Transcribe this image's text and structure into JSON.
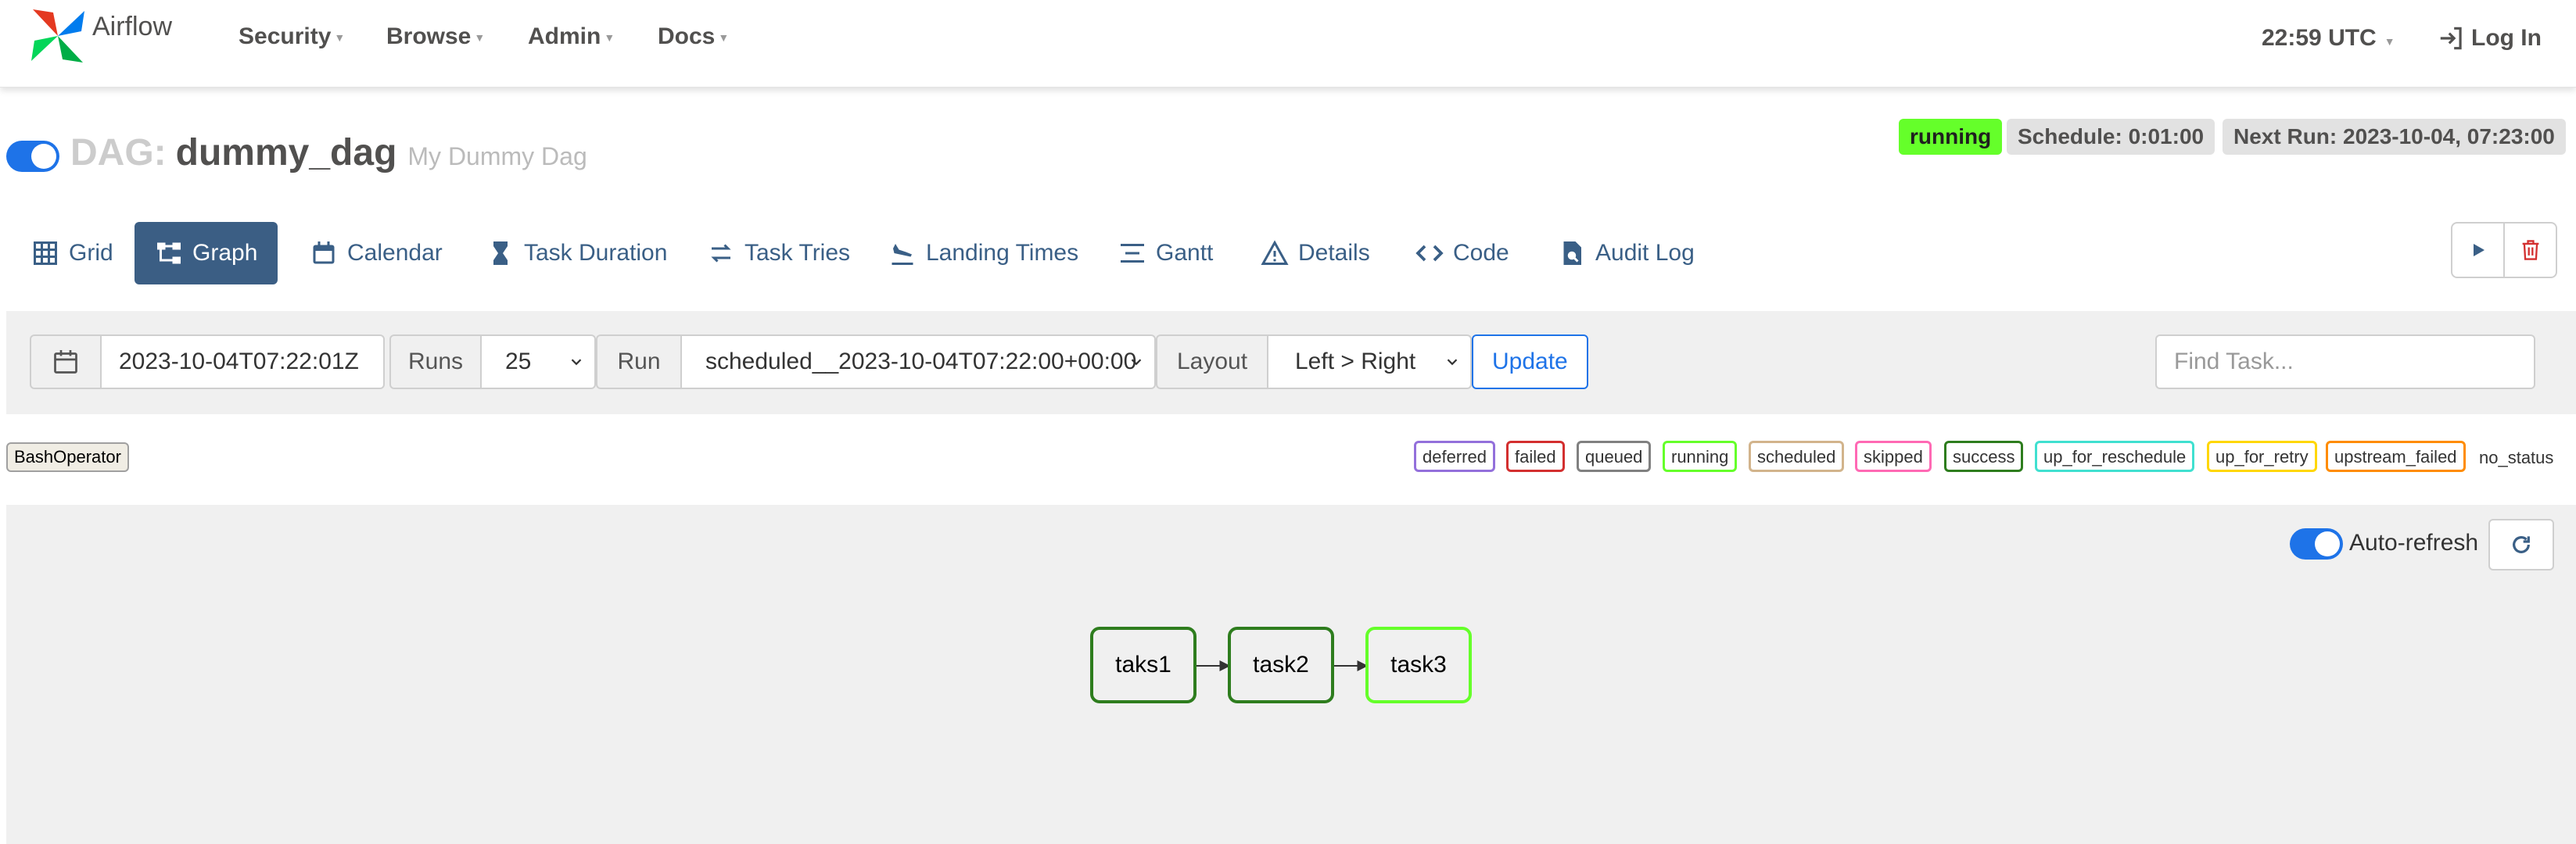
{
  "nav": {
    "brand": "Airflow",
    "menu": [
      {
        "label": "Security"
      },
      {
        "label": "Browse"
      },
      {
        "label": "Admin"
      },
      {
        "label": "Docs"
      }
    ],
    "time": "22:59 UTC",
    "login": "Log In"
  },
  "dag": {
    "prefix": "DAG:",
    "id": "dummy_dag",
    "description": "My Dummy Dag",
    "paused": false,
    "state_badge": "running",
    "schedule": "Schedule: 0:01:00",
    "next_run": "Next Run: 2023-10-04, 07:23:00"
  },
  "tabs": [
    {
      "label": "Grid",
      "icon": "grid-icon",
      "active": false
    },
    {
      "label": "Graph",
      "icon": "graph-icon",
      "active": true
    },
    {
      "label": "Calendar",
      "icon": "calendar-icon",
      "active": false
    },
    {
      "label": "Task Duration",
      "icon": "hourglass-icon",
      "active": false
    },
    {
      "label": "Task Tries",
      "icon": "retry-icon",
      "active": false
    },
    {
      "label": "Landing Times",
      "icon": "plane-landing-icon",
      "active": false
    },
    {
      "label": "Gantt",
      "icon": "gantt-icon",
      "active": false
    },
    {
      "label": "Details",
      "icon": "warning-triangle-icon",
      "active": false
    },
    {
      "label": "Code",
      "icon": "code-icon",
      "active": false
    },
    {
      "label": "Audit Log",
      "icon": "file-search-icon",
      "active": false
    }
  ],
  "filters": {
    "base_date": "2023-10-04T07:22:01Z",
    "runs_label": "Runs",
    "runs_value": "25",
    "run_label": "Run",
    "run_value": "scheduled__2023-10-04T07:22:00+00:00",
    "layout_label": "Layout",
    "layout_value": "Left > Right",
    "update": "Update",
    "find_placeholder": "Find Task..."
  },
  "operator_legend": "BashOperator",
  "state_legend": [
    {
      "label": "deferred",
      "color": "#9370db"
    },
    {
      "label": "failed",
      "color": "#d32f2f"
    },
    {
      "label": "queued",
      "color": "#808080"
    },
    {
      "label": "running",
      "color": "#65ff2a"
    },
    {
      "label": "scheduled",
      "color": "#d2b48c"
    },
    {
      "label": "skipped",
      "color": "#ff69b4"
    },
    {
      "label": "success",
      "color": "#2e7d1e"
    },
    {
      "label": "up_for_reschedule",
      "color": "#40e0d0"
    },
    {
      "label": "up_for_retry",
      "color": "#ffd700"
    },
    {
      "label": "upstream_failed",
      "color": "#ff8c00"
    }
  ],
  "no_status": "no_status",
  "graph": {
    "auto_refresh_label": "Auto-refresh",
    "auto_refresh": true,
    "nodes": [
      {
        "label": "taks1",
        "state": "success",
        "color": "#2e7d1e"
      },
      {
        "label": "task2",
        "state": "success",
        "color": "#2e7d1e"
      },
      {
        "label": "task3",
        "state": "running",
        "color": "#65ff2a"
      }
    ]
  },
  "colors": {
    "accent": "#1e73e8",
    "active_tab": "#3b5e84"
  }
}
